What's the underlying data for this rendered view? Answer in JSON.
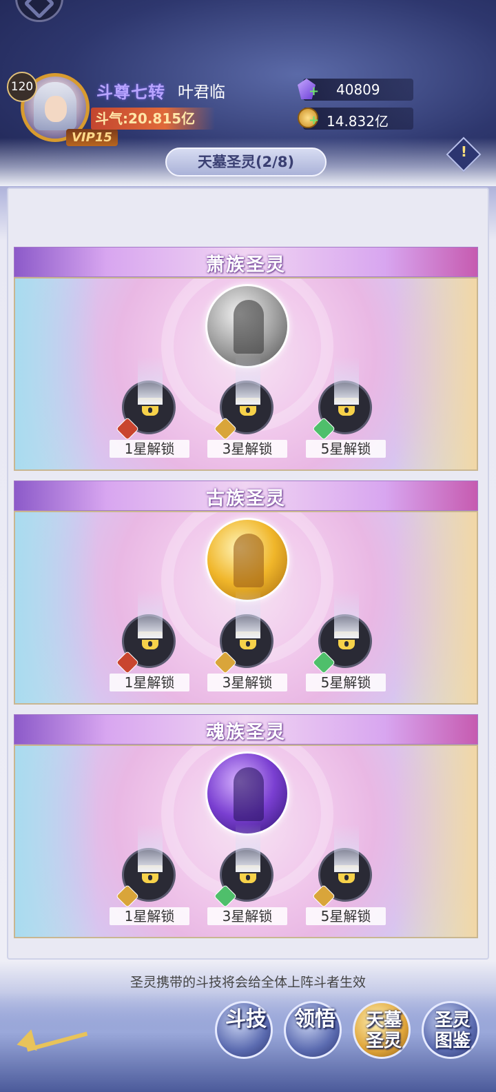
{
  "header": {
    "level": "120",
    "rank_title": "斗尊七转",
    "player_name": "叶君临",
    "power": "斗气:20.815亿",
    "vip": "VIP15",
    "gems": "40809",
    "gold": "14.832亿",
    "page_title": "天墓圣灵(2/8)"
  },
  "cards": [
    {
      "title": "萧族圣灵",
      "orb": "silver",
      "slots": [
        {
          "label": "1星解锁",
          "badge": "red"
        },
        {
          "label": "3星解锁",
          "badge": "gold"
        },
        {
          "label": "5星解锁",
          "badge": "green"
        }
      ]
    },
    {
      "title": "古族圣灵",
      "orb": "gold",
      "slots": [
        {
          "label": "1星解锁",
          "badge": "red"
        },
        {
          "label": "3星解锁",
          "badge": "gold"
        },
        {
          "label": "5星解锁",
          "badge": "green"
        }
      ]
    },
    {
      "title": "魂族圣灵",
      "orb": "purple",
      "slots": [
        {
          "label": "1星解锁",
          "badge": "gold"
        },
        {
          "label": "3星解锁",
          "badge": "green"
        },
        {
          "label": "5星解锁",
          "badge": "gold"
        }
      ]
    }
  ],
  "footer_note": "圣灵携带的斗技将会给全体上阵斗者生效",
  "nav": [
    {
      "label": "斗技",
      "active": false
    },
    {
      "label": "领悟",
      "active": false
    },
    {
      "label": "天墓圣灵",
      "active": true
    },
    {
      "label": "圣灵图鉴",
      "active": false
    }
  ],
  "icons": [
    "back-icon",
    "gem-icon",
    "coin-icon",
    "help-icon",
    "lock-icon",
    "arrow-icon"
  ]
}
